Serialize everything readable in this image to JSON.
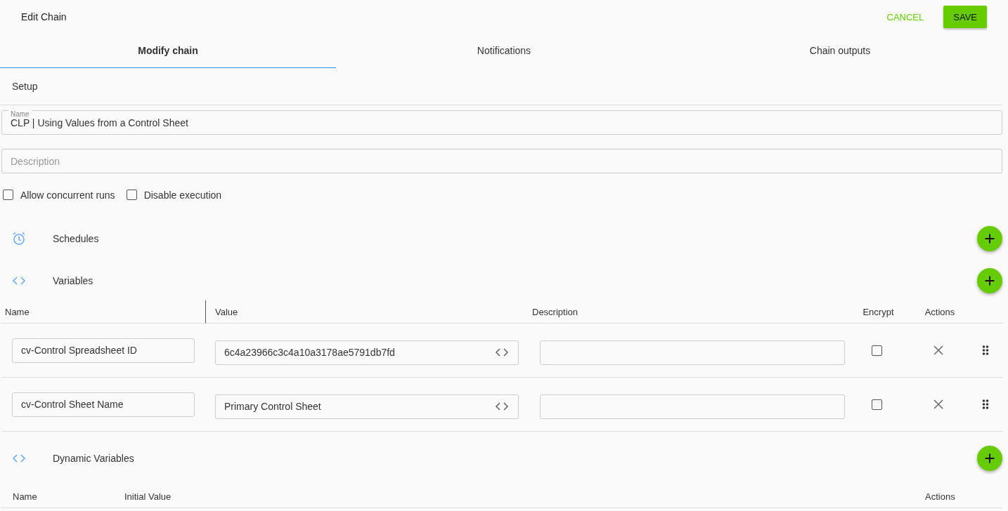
{
  "header": {
    "title": "Edit Chain",
    "cancel": "CANCEL",
    "save": "SAVE"
  },
  "tabs": [
    {
      "label": "Modify chain",
      "selected": true
    },
    {
      "label": "Notifications",
      "selected": false
    },
    {
      "label": "Chain outputs",
      "selected": false
    }
  ],
  "setup": {
    "title": "Setup",
    "name_field": {
      "label": "Name",
      "value": "CLP | Using Values from a Control Sheet"
    },
    "description_field": {
      "placeholder": "Description"
    },
    "options": [
      {
        "label": "Allow concurrent runs",
        "checked": false
      },
      {
        "label": "Disable execution",
        "checked": false
      }
    ]
  },
  "schedules": {
    "title": "Schedules"
  },
  "variables": {
    "title": "Variables",
    "columns": [
      "Name",
      "Value",
      "Description",
      "Encrypt",
      "Actions"
    ],
    "rows": [
      {
        "name": "cv-Control Spreadsheet ID",
        "value": "6c4a23966c3c4a10a3178ae5791db7fd",
        "encrypt": false
      },
      {
        "name": "cv-Control Sheet Name",
        "value": "Primary Control Sheet",
        "encrypt": false
      }
    ]
  },
  "dynamic_variables": {
    "title": "Dynamic Variables",
    "columns": [
      "Name",
      "Initial Value",
      "Actions"
    ]
  }
}
